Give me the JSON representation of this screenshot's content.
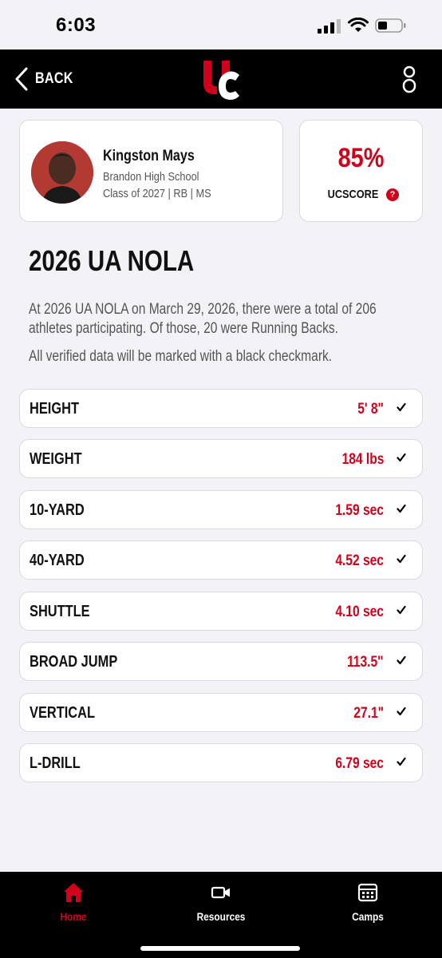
{
  "status": {
    "time": "6:03"
  },
  "header": {
    "back_label": "BACK",
    "logo_icon": "uc-logo",
    "user_icon": "user-icon"
  },
  "profile": {
    "name": "Kingston Mays",
    "school": "Brandon High School",
    "details": "Class of 2027 | RB | MS"
  },
  "score": {
    "value": "85%",
    "label": "UCSCORE",
    "help": "?"
  },
  "event": {
    "title": "2026 UA NOLA",
    "description": "At 2026 UA NOLA on March 29, 2026, there were a total of 206 athletes participating. Of those, 20 were Running Backs.",
    "note": "All verified data will be marked with a black checkmark."
  },
  "metrics": [
    {
      "label": "HEIGHT",
      "value": "5' 8\"",
      "verified": true
    },
    {
      "label": "WEIGHT",
      "value": "184 lbs",
      "verified": true
    },
    {
      "label": "10-YARD",
      "value": "1.59 sec",
      "verified": true
    },
    {
      "label": "40-YARD",
      "value": "4.52 sec",
      "verified": true
    },
    {
      "label": "SHUTTLE",
      "value": "4.10 sec",
      "verified": true
    },
    {
      "label": "BROAD JUMP",
      "value": "113.5\"",
      "verified": true
    },
    {
      "label": "VERTICAL",
      "value": "27.1\"",
      "verified": true
    },
    {
      "label": "L-DRILL",
      "value": "6.79 sec",
      "verified": true
    }
  ],
  "nav": {
    "items": [
      {
        "label": "Home",
        "icon": "home-icon",
        "active": true
      },
      {
        "label": "Resources",
        "icon": "video-icon",
        "active": false
      },
      {
        "label": "Camps",
        "icon": "calendar-icon",
        "active": false
      }
    ]
  },
  "colors": {
    "accent": "#d0021b",
    "header_bg": "#000000",
    "page_bg": "#f2f2f7"
  }
}
